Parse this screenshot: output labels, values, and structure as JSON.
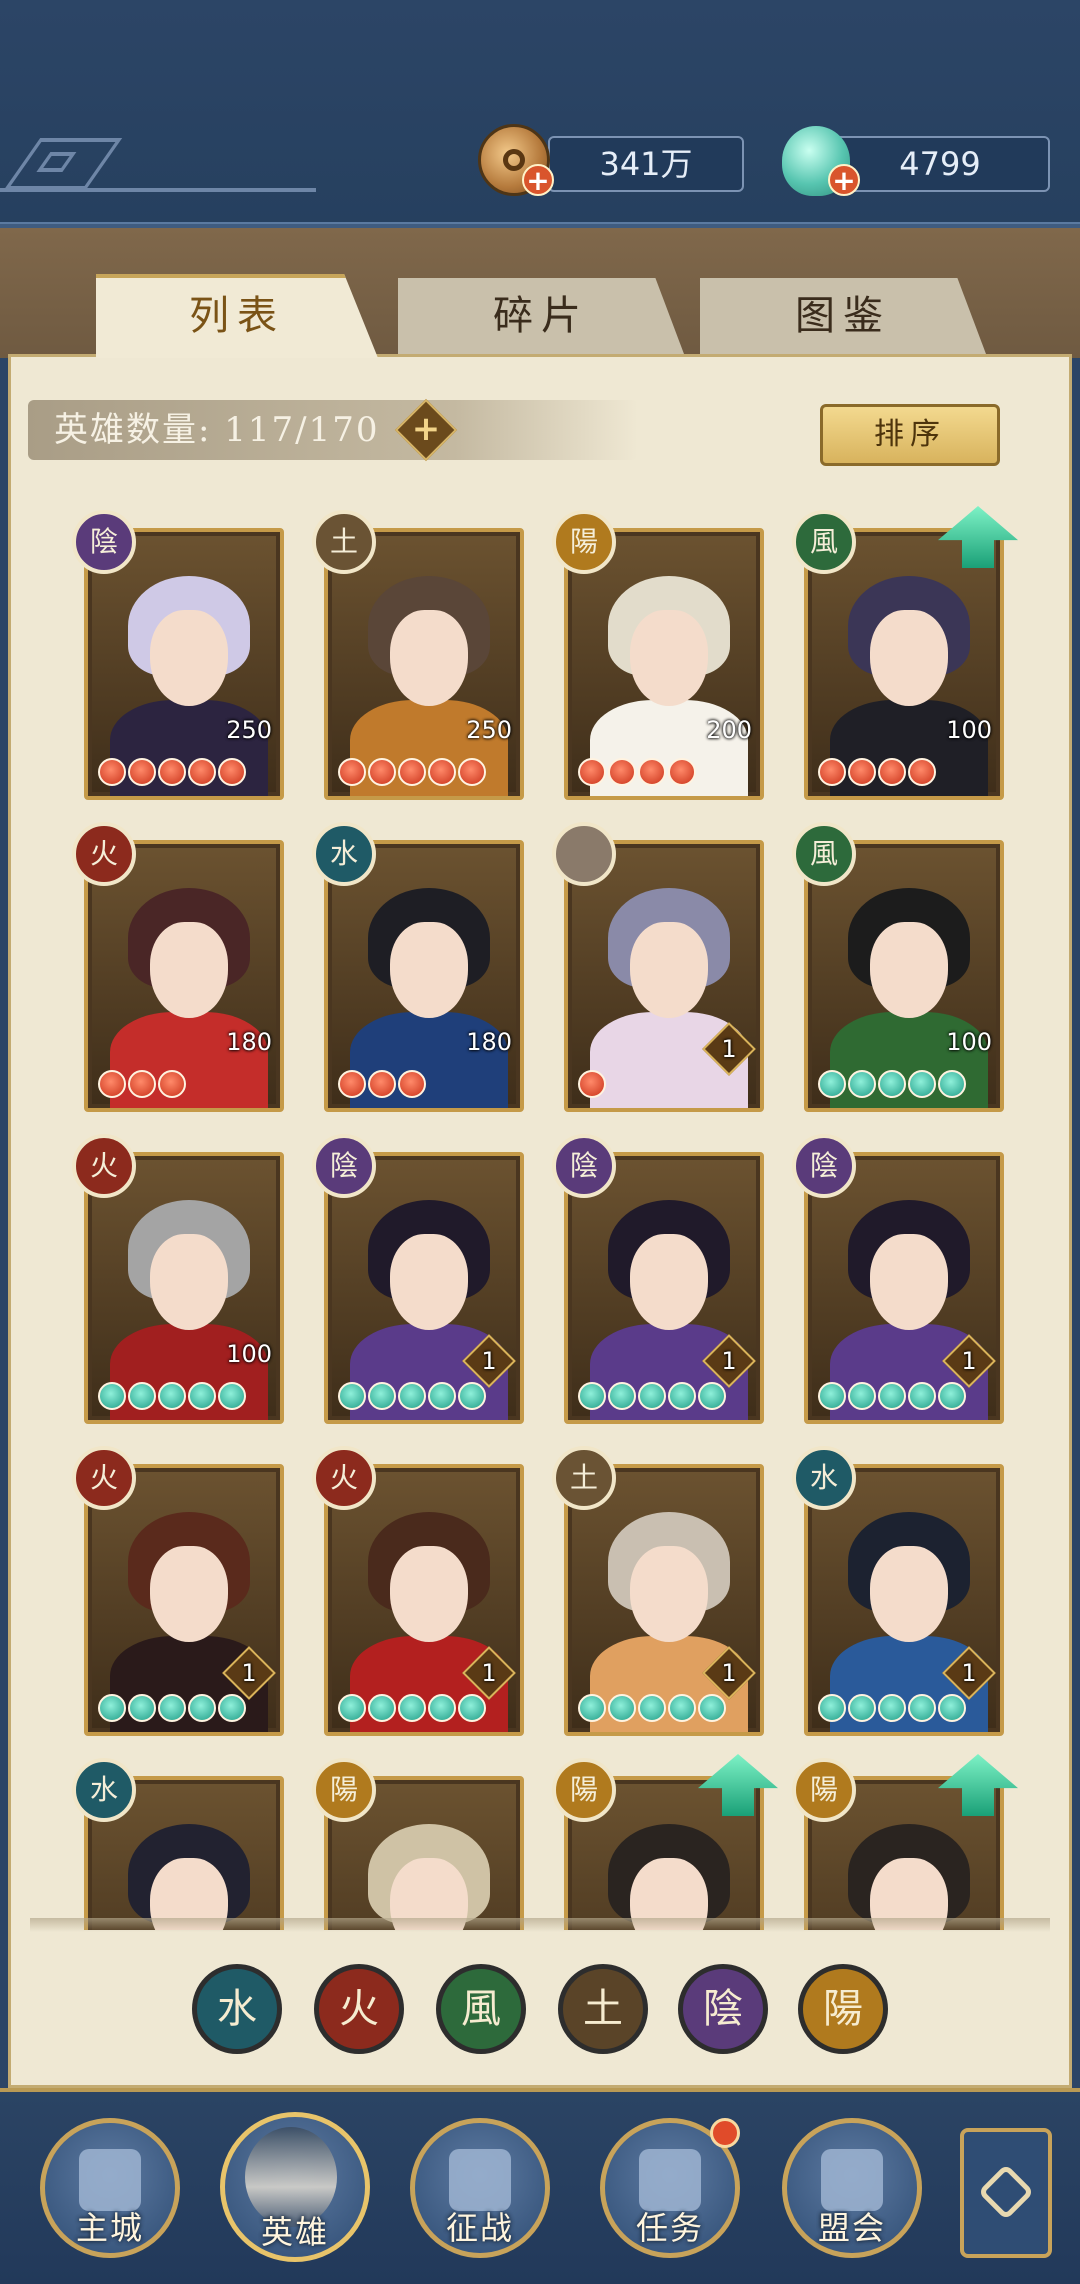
{
  "currencies": {
    "coins": "341万",
    "jade": "4799",
    "coins_icon": "coin-icon",
    "jade_icon": "jade-shell-icon",
    "add_symbol": "+"
  },
  "tabs": [
    {
      "label": "列表",
      "active": true
    },
    {
      "label": "碎片",
      "active": false
    },
    {
      "label": "图鉴",
      "active": false
    }
  ],
  "hero_count": {
    "label": "英雄数量: 117/170",
    "add_symbol": "+"
  },
  "sort_button": "排序",
  "heroes": [
    {
      "element": "陰",
      "elem_class": "yin",
      "level": "250",
      "stars": 5,
      "star_color": "red",
      "upgrade": false,
      "hair": "#cfc9e6",
      "robe": "#2c2440"
    },
    {
      "element": "土",
      "elem_class": "tu",
      "level": "250",
      "stars": 5,
      "star_color": "red",
      "upgrade": false,
      "hair": "#5a4638",
      "robe": "#c07a2c"
    },
    {
      "element": "陽",
      "elem_class": "yang",
      "level": "200",
      "stars": 4,
      "star_color": "red",
      "upgrade": false,
      "hair": "#e2dccb",
      "robe": "#f5f2ea"
    },
    {
      "element": "風",
      "elem_class": "feng",
      "level": "100",
      "stars": 4,
      "star_color": "red",
      "upgrade": true,
      "hair": "#3b3656",
      "robe": "#1f1f26"
    },
    {
      "element": "火",
      "elem_class": "huo",
      "level": "180",
      "stars": 3,
      "star_color": "red",
      "upgrade": false,
      "hair": "#4a2626",
      "robe": "#c42d2a"
    },
    {
      "element": "水",
      "elem_class": "shui",
      "level": "180",
      "stars": 3,
      "star_color": "red",
      "upgrade": false,
      "hair": "#1e1e24",
      "robe": "#1f3f7a"
    },
    {
      "element": "",
      "elem_class": "cloud",
      "level": "1",
      "stars": 1,
      "star_color": "red",
      "upgrade": false,
      "hair": "#8a8aa8",
      "robe": "#e8d6e6"
    },
    {
      "element": "風",
      "elem_class": "feng",
      "level": "100",
      "stars": 5,
      "star_color": "jade",
      "upgrade": false,
      "hair": "#1c1c1c",
      "robe": "#2f6a32"
    },
    {
      "element": "火",
      "elem_class": "huo",
      "level": "100",
      "stars": 5,
      "star_color": "jade",
      "upgrade": false,
      "hair": "#a4a4a4",
      "robe": "#a11f1f"
    },
    {
      "element": "陰",
      "elem_class": "yin",
      "level": "1",
      "stars": 5,
      "star_color": "jade",
      "upgrade": false,
      "hair": "#201a2a",
      "robe": "#5a3b8a"
    },
    {
      "element": "陰",
      "elem_class": "yin",
      "level": "1",
      "stars": 5,
      "star_color": "jade",
      "upgrade": false,
      "hair": "#201a2a",
      "robe": "#5a3b8a"
    },
    {
      "element": "陰",
      "elem_class": "yin",
      "level": "1",
      "stars": 5,
      "star_color": "jade",
      "upgrade": false,
      "hair": "#201a2a",
      "robe": "#5a3b8a"
    },
    {
      "element": "火",
      "elem_class": "huo",
      "level": "1",
      "stars": 5,
      "star_color": "jade",
      "upgrade": false,
      "hair": "#5a2a1c",
      "robe": "#2a1a1a"
    },
    {
      "element": "火",
      "elem_class": "huo",
      "level": "1",
      "stars": 5,
      "star_color": "jade",
      "upgrade": false,
      "hair": "#4a2a1c",
      "robe": "#b3201f"
    },
    {
      "element": "土",
      "elem_class": "tu",
      "level": "1",
      "stars": 5,
      "star_color": "jade",
      "upgrade": false,
      "hair": "#c9bfb1",
      "robe": "#e0a060"
    },
    {
      "element": "水",
      "elem_class": "shui",
      "level": "1",
      "stars": 5,
      "star_color": "jade",
      "upgrade": false,
      "hair": "#1c2230",
      "robe": "#2a5a9a"
    },
    {
      "element": "水",
      "elem_class": "shui",
      "level": "",
      "stars": 0,
      "star_color": "jade",
      "upgrade": false,
      "hair": "#222230",
      "robe": "#8ab0d8"
    },
    {
      "element": "陽",
      "elem_class": "yang",
      "level": "",
      "stars": 0,
      "star_color": "jade",
      "upgrade": false,
      "hair": "#cfc2a5",
      "robe": "#3a3226"
    },
    {
      "element": "陽",
      "elem_class": "yang",
      "level": "",
      "stars": 0,
      "star_color": "jade",
      "upgrade": true,
      "hair": "#2a2420",
      "robe": "#e8c84a"
    },
    {
      "element": "陽",
      "elem_class": "yang",
      "level": "",
      "stars": 0,
      "star_color": "jade",
      "upgrade": true,
      "hair": "#2a2420",
      "robe": "#e8c84a"
    }
  ],
  "element_filters": [
    {
      "label": "水",
      "cls": "shui"
    },
    {
      "label": "火",
      "cls": "huo"
    },
    {
      "label": "風",
      "cls": "feng"
    },
    {
      "label": "土",
      "cls": "tu"
    },
    {
      "label": "陰",
      "cls": "yin"
    },
    {
      "label": "陽",
      "cls": "yang"
    }
  ],
  "bottom_nav": [
    {
      "label": "主城",
      "icon": "city-gate-icon",
      "active": false
    },
    {
      "label": "英雄",
      "icon": "hero-portrait-icon",
      "active": true
    },
    {
      "label": "征战",
      "icon": "war-drum-icon",
      "active": false
    },
    {
      "label": "任务",
      "icon": "scroll-bell-icon",
      "active": false,
      "badge": true
    },
    {
      "label": "盟会",
      "icon": "guild-pavilion-icon",
      "active": false
    }
  ],
  "more_icon": "knot-icon"
}
